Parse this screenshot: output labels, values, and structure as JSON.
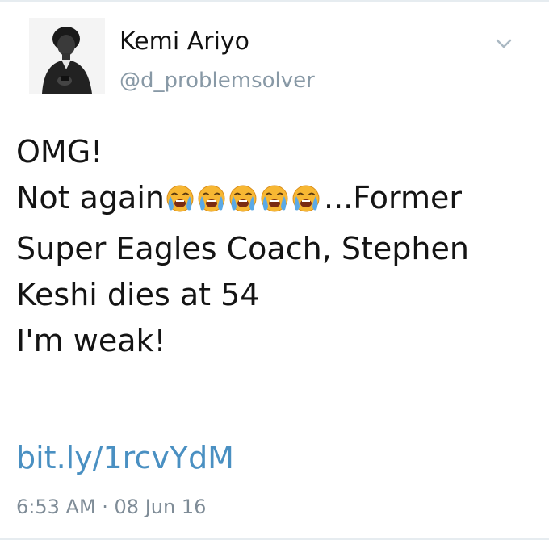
{
  "tweet": {
    "author": {
      "display_name": "Kemi Ariyo",
      "handle": "@d_problemsolver",
      "avatar_icon": "profile-photo"
    },
    "menu_icon": "chevron-down-icon",
    "text_lines": {
      "line1": "OMG!",
      "line2_start": "Not again",
      "line2_end": "...Former",
      "line3": "Super Eagles Coach, Stephen",
      "line4": "Keshi dies at 54",
      "line5": "I'm weak!"
    },
    "emoji": {
      "name": "loudly-crying-face-icon",
      "count": 5
    },
    "link": "bit.ly/1rcvYdM",
    "timestamp": "6:53 AM · 08 Jun 16"
  },
  "colors": {
    "text": "#141414",
    "handle": "#8899a6",
    "link": "#4a90c2",
    "timestamp": "#7f8c97",
    "emoji_face": "#f7b733",
    "emoji_tears": "#5aa9e6"
  }
}
